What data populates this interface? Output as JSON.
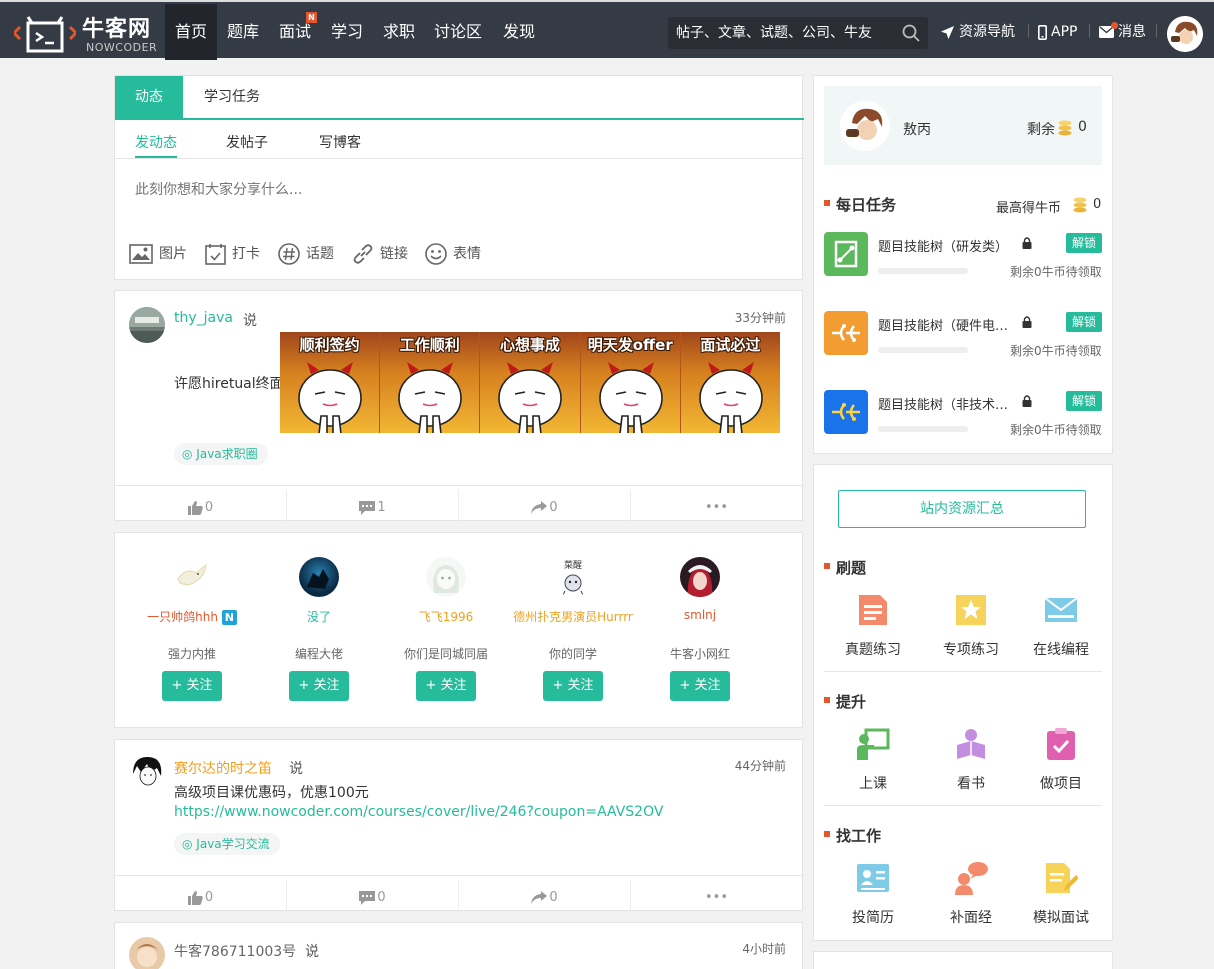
{
  "header": {
    "logo_cn": "牛客网",
    "logo_en": "NOWCODER",
    "nav": [
      {
        "label": "首页",
        "active": true
      },
      {
        "label": "题库"
      },
      {
        "label": "面试",
        "badge": "N"
      },
      {
        "label": "学习"
      },
      {
        "label": "求职"
      },
      {
        "label": "讨论区"
      },
      {
        "label": "发现"
      }
    ],
    "search_placeholder": "帖子、文章、试题、公司、牛友",
    "resource_nav": "资源导航",
    "app": "APP",
    "messages": "消息",
    "accent": "#25bb9b",
    "bar_color": "#353b44"
  },
  "composer": {
    "tabs": [
      "动态",
      "学习任务"
    ],
    "subtabs": [
      "发动态",
      "发帖子",
      "写博客"
    ],
    "placeholder": "此刻你想和大家分享什么...",
    "tools": [
      "图片",
      "打卡",
      "话题",
      "链接",
      "表情"
    ]
  },
  "posts": [
    {
      "user": "thy_java",
      "says": "说",
      "time": "33分钟前",
      "text": "许愿hiretual终面",
      "meme_captions": [
        "顺利签约",
        "工作顺利",
        "心想事成",
        "明天发offer",
        "面试必过"
      ],
      "tag": "Java求职圈",
      "likes": "0",
      "comments": "1",
      "shares": "0",
      "more": "•••"
    },
    {
      "user": "赛尔达的时之笛",
      "says": "说",
      "time": "44分钟前",
      "text": "高级项目课优惠码，优惠100元",
      "link": "https://www.nowcoder.com/courses/cover/live/246?coupon=AAVS2OV",
      "tag": "Java学习交流",
      "likes": "0",
      "comments": "0",
      "shares": "0",
      "more": "•••"
    },
    {
      "user": "牛客786711003号",
      "says": "说",
      "time": "4小时前"
    }
  ],
  "recommend": [
    {
      "name": "一只帅鸽hhh",
      "badge": "N",
      "desc": "强力内推",
      "color": "#e4572e",
      "follow": "+ 关注"
    },
    {
      "name": "没了",
      "desc": "编程大佬",
      "color": "#25bb9b",
      "follow": "+ 关注"
    },
    {
      "name": "飞飞1996",
      "desc": "你们是同城同届",
      "color": "#f0a020",
      "follow": "+ 关注"
    },
    {
      "name": "德州扑克男演员Hurrrr",
      "desc": "你的同学",
      "color": "#f0a020",
      "follow": "+ 关注"
    },
    {
      "name": "smlnj",
      "desc": "牛客小网红",
      "color": "#e4572e",
      "follow": "+ 关注"
    }
  ],
  "profile": {
    "name": "敖丙",
    "balance_label": "剩余",
    "balance": "0"
  },
  "daily": {
    "title": "每日任务",
    "max_label": "最高得牛币",
    "max": "0",
    "tasks": [
      {
        "name": "题目技能树（研发类）",
        "unlock": "解锁",
        "reward": "剩余0牛币待领取",
        "icon_color": "#5cb85c"
      },
      {
        "name": "题目技能树（硬件电…",
        "unlock": "解锁",
        "reward": "剩余0牛币待领取",
        "icon_color": "#f39c32"
      },
      {
        "name": "题目技能树（非技术…",
        "unlock": "解锁",
        "reward": "剩余0牛币待领取",
        "icon_color": "#1a73e8"
      }
    ]
  },
  "resources": {
    "button": "站内资源汇总",
    "sections": [
      {
        "title": "刷题",
        "items": [
          "真题练习",
          "专项练习",
          "在线编程"
        ]
      },
      {
        "title": "提升",
        "items": [
          "上课",
          "看书",
          "做项目"
        ]
      },
      {
        "title": "找工作",
        "items": [
          "投简历",
          "补面经",
          "模拟面试"
        ]
      }
    ]
  }
}
